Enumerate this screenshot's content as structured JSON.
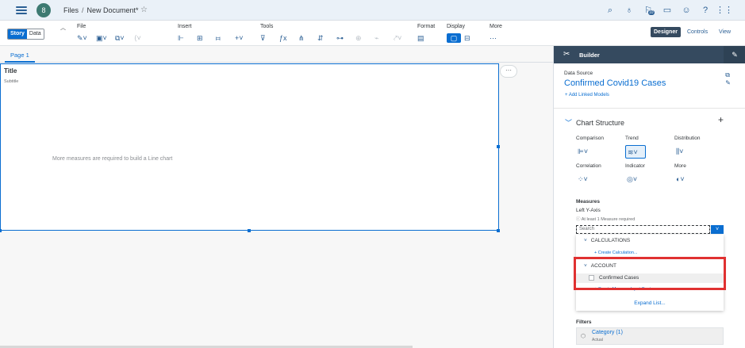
{
  "shell": {
    "avatar_initial": "8",
    "breadcrumb_root": "Files",
    "breadcrumb_sep": "/",
    "document_name": "New Document*",
    "notification_count": "10"
  },
  "toolbar": {
    "story_label": "Story",
    "data_label": "Data",
    "groups": {
      "file": "File",
      "insert": "Insert",
      "tools": "Tools",
      "format": "Format",
      "display": "Display",
      "more": "More"
    },
    "modes": [
      "Designer",
      "Controls",
      "View"
    ]
  },
  "page": {
    "tab_label": "Page 1"
  },
  "chart": {
    "title": "Title",
    "subtitle": "Subtitle",
    "message": "More measures are required to build a Line chart"
  },
  "builder": {
    "header": "Builder",
    "datasource_label": "Data Source",
    "datasource_name": "Confirmed Covid19 Cases",
    "add_linked": "Add Linked Models",
    "chart_structure": "Chart Structure",
    "chart_types": [
      "Comparison",
      "Trend",
      "Distribution",
      "Correlation",
      "Indicator",
      "More"
    ],
    "measures_label": "Measures",
    "left_axis": "Left Y-Axis",
    "requirement": "At least 1 Measure required",
    "search_placeholder": "Search",
    "dropdown": {
      "group1": "CALCULATIONS",
      "group1_link": "+ Create Calculation...",
      "group2": "ACCOUNT",
      "group2_item": "Confirmed Cases",
      "group2_link": "+ Create Measure Input Contro...",
      "expand": "Expand List..."
    },
    "filters_label": "Filters",
    "filter_title": "Category (1)",
    "filter_value": "Actual"
  },
  "colors": {
    "accent": "#0a6ed1",
    "header_dark": "#354a5f",
    "highlight": "#e03131"
  }
}
